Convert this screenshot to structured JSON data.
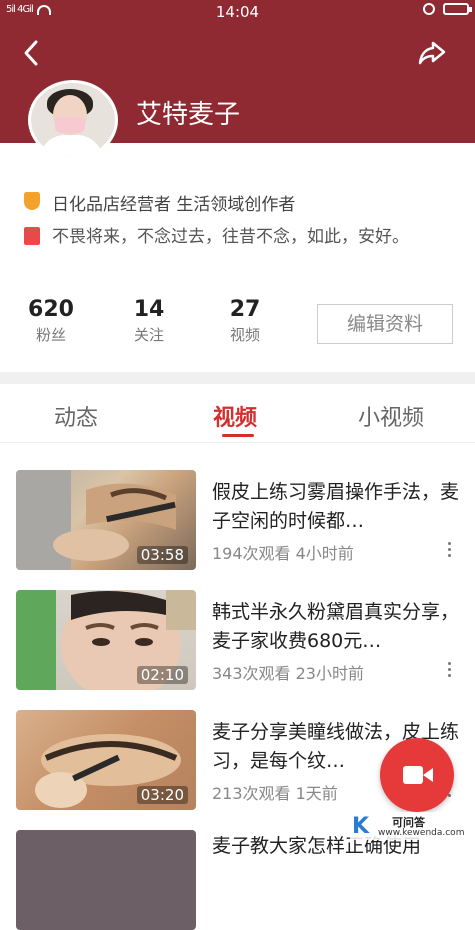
{
  "status_bar": {
    "signal": "5il 4Gil",
    "time": "14:04"
  },
  "profile": {
    "name": "艾特麦子",
    "badge_text": "日化品店经营者 生活领域创作者",
    "bio": "不畏将来，不念过去，往昔不念，如此，安好。"
  },
  "stats": [
    {
      "value": "620",
      "label": "粉丝"
    },
    {
      "value": "14",
      "label": "关注"
    },
    {
      "value": "27",
      "label": "视频"
    }
  ],
  "edit_button": "编辑资料",
  "tabs": [
    {
      "label": "动态",
      "active": false
    },
    {
      "label": "视频",
      "active": true
    },
    {
      "label": "小视频",
      "active": false
    }
  ],
  "videos": [
    {
      "title": "假皮上练习雾眉操作手法，麦子空闲的时候都…",
      "duration": "03:58",
      "meta": "194次观看 4小时前"
    },
    {
      "title": "韩式半永久粉黛眉真实分享，麦子家收费680元…",
      "duration": "02:10",
      "meta": "343次观看 23小时前"
    },
    {
      "title": "麦子分享美瞳线做法，皮上练习，是每个纹…",
      "duration": "03:20",
      "meta": "213次观看 1天前"
    },
    {
      "title": "麦子教大家怎样正确使用",
      "duration": "",
      "meta": ""
    }
  ],
  "watermark": {
    "logo": "K",
    "line1": "可问答",
    "line2": "www.kewenda.com"
  },
  "colors": {
    "header": "#8f2a33",
    "accent": "#d42f2f",
    "fab": "#e63a3a"
  }
}
